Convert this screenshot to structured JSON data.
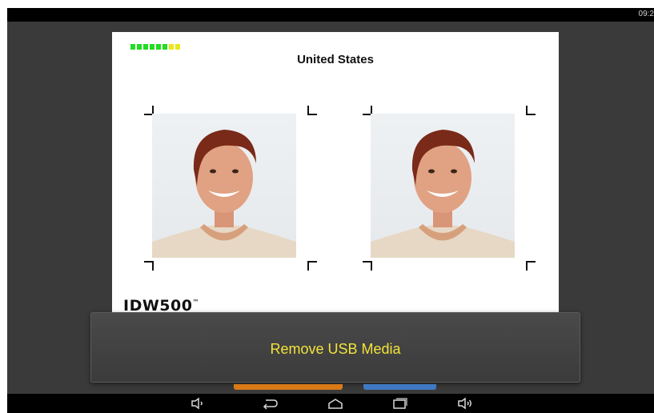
{
  "statusbar": {
    "clock": "09:2"
  },
  "card": {
    "title": "United States",
    "brand": "IDW500",
    "brand_mark": "™",
    "level_colors": [
      "#22dd22",
      "#22dd22",
      "#22dd22",
      "#22dd22",
      "#22dd22",
      "#22dd22",
      "#e8e820",
      "#e8e820"
    ]
  },
  "photos": [
    {
      "subject": "portrait-photo-left"
    },
    {
      "subject": "portrait-photo-right"
    }
  ],
  "toast": {
    "message": "Remove USB Media"
  },
  "buttons": {
    "orange_color": "#d97a16",
    "blue_color": "#3f79c3"
  },
  "navbar": {
    "icons": [
      "volume-down-icon",
      "back-icon",
      "home-icon",
      "recents-icon",
      "volume-up-icon"
    ]
  },
  "colors": {
    "background": "#3a3a3a",
    "toast_text": "#f2e33a"
  }
}
